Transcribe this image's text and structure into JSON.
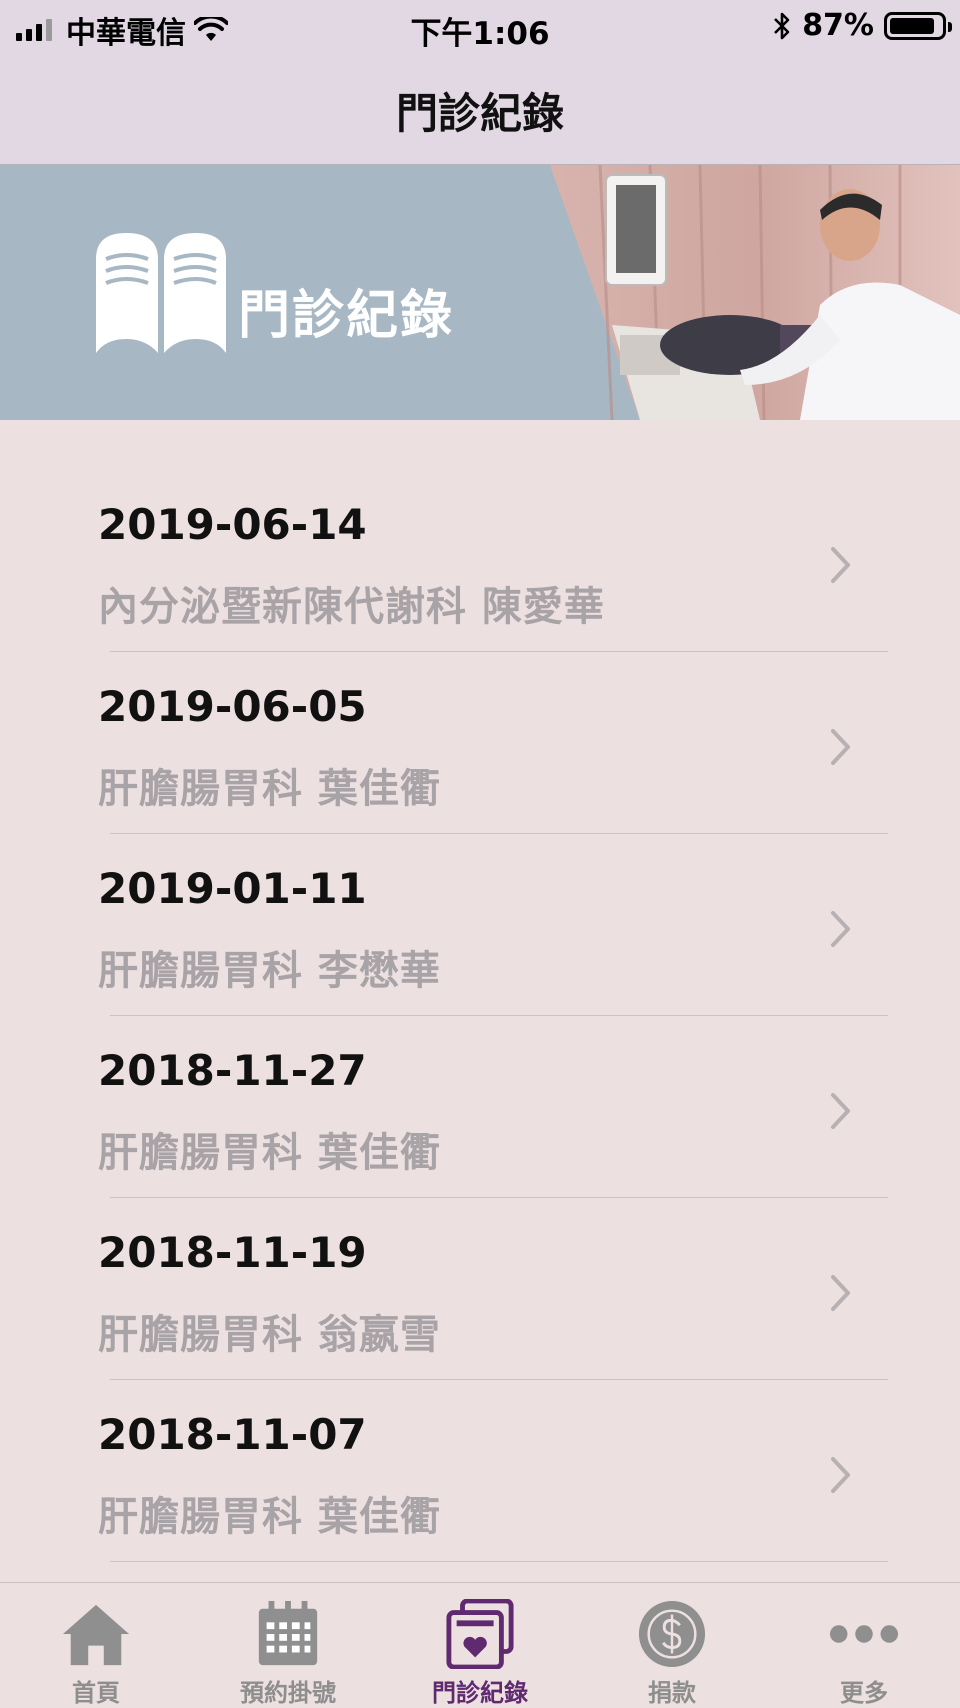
{
  "status_bar": {
    "carrier": "中華電信",
    "time": "下午1:06",
    "battery": "87%"
  },
  "nav": {
    "title": "門診紀錄"
  },
  "banner": {
    "title": "門診紀錄"
  },
  "records": [
    {
      "date": "2019-06-14",
      "desc": "內分泌暨新陳代謝科  陳愛華"
    },
    {
      "date": "2019-06-05",
      "desc": "肝膽腸胃科  葉佳衢"
    },
    {
      "date": "2019-01-11",
      "desc": "肝膽腸胃科  李懋華"
    },
    {
      "date": "2018-11-27",
      "desc": "肝膽腸胃科  葉佳衢"
    },
    {
      "date": "2018-11-19",
      "desc": "肝膽腸胃科  翁嬴雪"
    },
    {
      "date": "2018-11-07",
      "desc": "肝膽腸胃科  葉佳衢"
    }
  ],
  "tabs": [
    {
      "label": "首頁",
      "icon": "home-icon"
    },
    {
      "label": "預約掛號",
      "icon": "calendar-icon"
    },
    {
      "label": "門診紀錄",
      "icon": "medical-record-icon",
      "active": true
    },
    {
      "label": "捐款",
      "icon": "dollar-icon"
    },
    {
      "label": "更多",
      "icon": "more-icon"
    }
  ],
  "colors": {
    "background": "#ede0e1",
    "nav_background": "#e1d8e3",
    "banner_blue": "#a7b7c4",
    "accent": "#5f2a6f",
    "secondary_text": "#a8a3a6"
  }
}
